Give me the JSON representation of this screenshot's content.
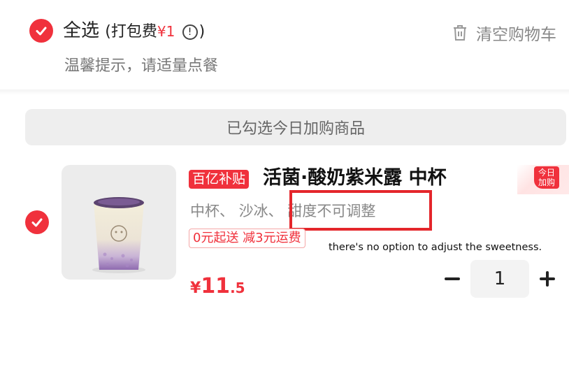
{
  "header": {
    "select_all_label": "全选",
    "pack_fee_prefix": "(打包费",
    "pack_fee_price": "¥1",
    "info_glyph": "!",
    "pack_fee_suffix": ")",
    "clear_cart_label": "清空购物车",
    "tip": "温馨提示，请适量点餐"
  },
  "banner": {
    "text": "已勾选今日加购商品"
  },
  "item": {
    "subsidy_badge": "百亿补贴",
    "name": "活菌·酸奶紫米露 中杯",
    "specs": "中杯、 沙冰、 甜度不可调整",
    "today_tag_line1": "今日",
    "today_tag_line2": "加购",
    "promo": "0元起送 减3元运费",
    "price_symbol": "¥",
    "price_int": "11",
    "price_dec": ".5",
    "quantity": "1",
    "selected": true
  },
  "annotation": "there's no option to adjust the sweetness.",
  "colors": {
    "accent": "#f0313c",
    "highlight_box": "#e4262b"
  },
  "icons": [
    "checkmark-icon",
    "info-icon",
    "trash-icon",
    "minus-icon",
    "plus-icon"
  ]
}
